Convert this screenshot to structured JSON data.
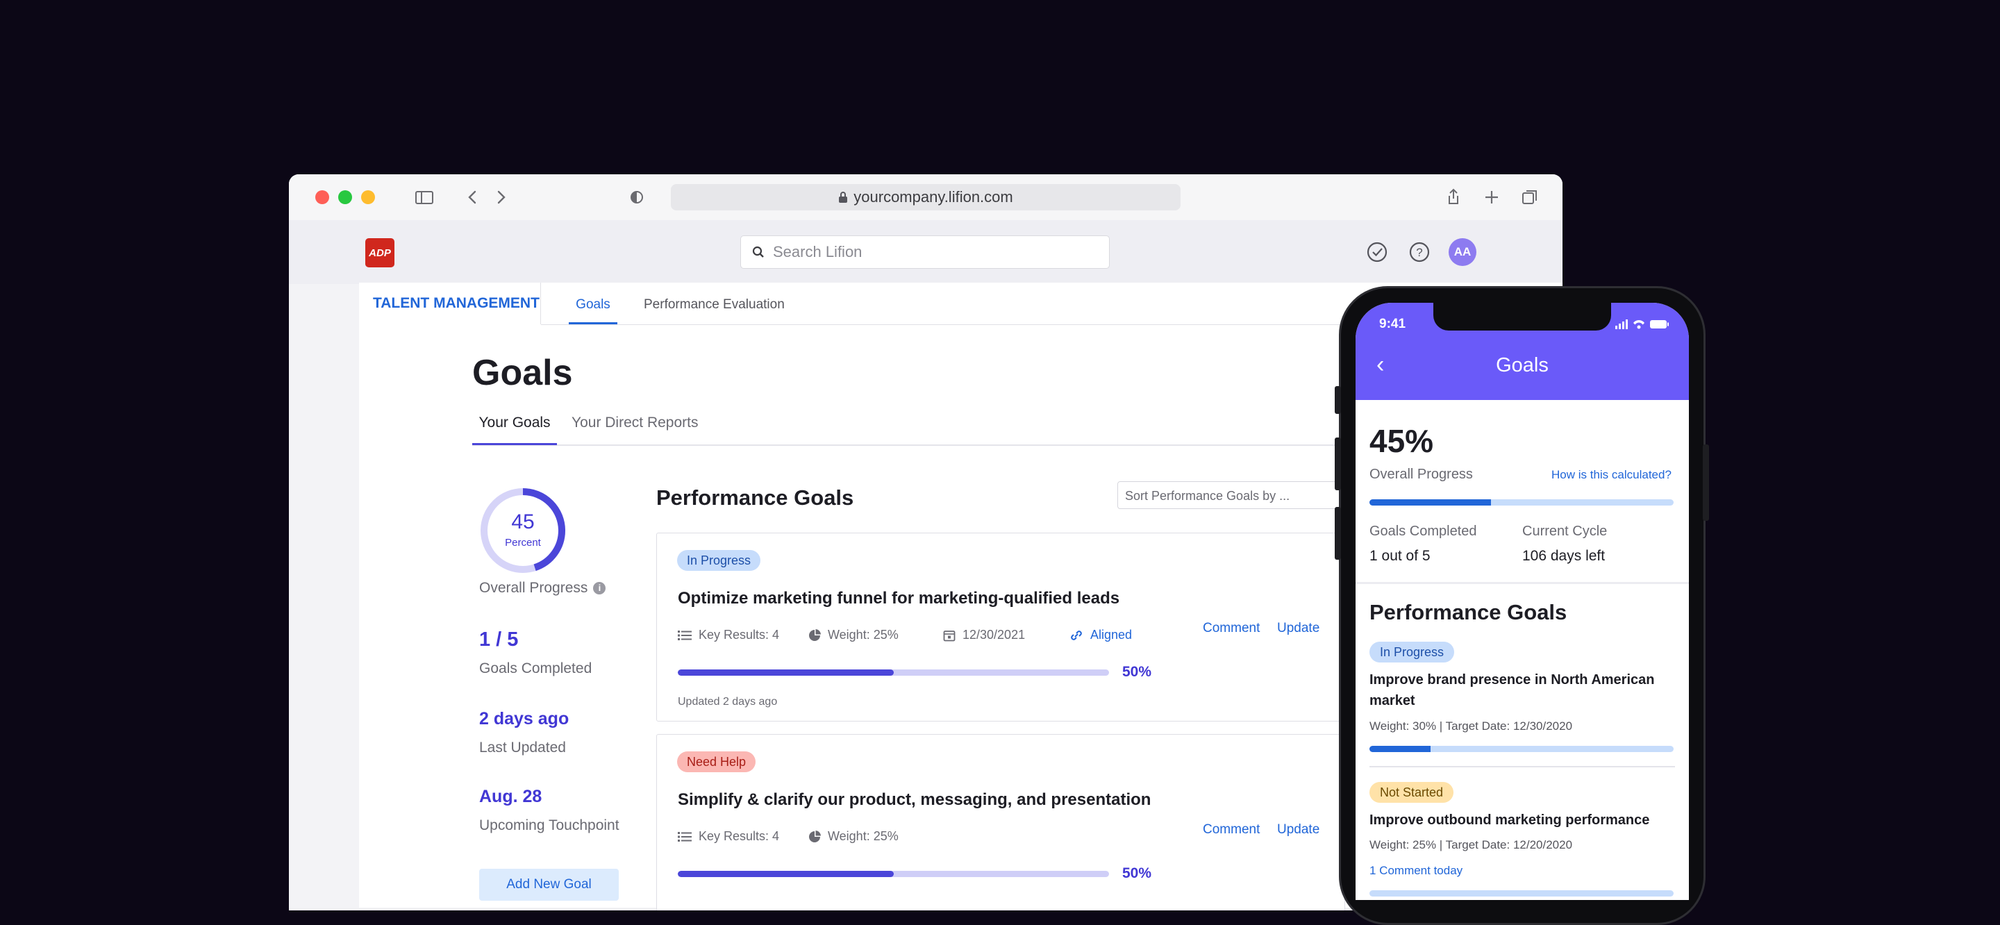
{
  "browser": {
    "url": "yourcompany.lifion.com",
    "colors": {
      "close": "#fe5f57",
      "minimize": "#28c840",
      "maximize": "#febc2e"
    }
  },
  "app": {
    "logo_text": "ADP",
    "search_placeholder": "Search Lifion",
    "avatar_initials": "AA",
    "module": "TALENT MANAGEMENT",
    "nav": [
      "Goals",
      "Performance Evaluation"
    ]
  },
  "page": {
    "title": "Goals",
    "tabs": [
      "Your Goals",
      "Your Direct Reports"
    ],
    "progress_ring": {
      "value": "45",
      "label": "Percent",
      "fraction": 0.45,
      "caption": "Overall Progress"
    },
    "stats": [
      {
        "value": "1 / 5",
        "label": "Goals Completed"
      },
      {
        "value": "2 days ago",
        "label": "Last Updated"
      },
      {
        "value": "Aug. 28",
        "label": "Upcoming Touchpoint"
      }
    ],
    "add_button": "Add New Goal",
    "perf_title": "Performance Goals",
    "sort_placeholder": "Sort Performance Goals by ...",
    "cards": [
      {
        "status": "In Progress",
        "title": "Optimize marketing funnel for marketing-qualified leads",
        "key_results": "Key Results: 4",
        "weight": "Weight: 25%",
        "date": "12/30/2021",
        "aligned": "Aligned",
        "comment": "Comment",
        "update": "Update",
        "progress": 0.5,
        "progress_label": "50%",
        "updated": "Updated 2 days ago"
      },
      {
        "status": "Need Help",
        "title": "Simplify & clarify our product, messaging, and presentation",
        "key_results": "Key Results: 4",
        "weight": "Weight: 25%",
        "comment": "Comment",
        "update": "Update",
        "progress": 0.5,
        "progress_label": "50%"
      }
    ]
  },
  "phone": {
    "time": "9:41",
    "title": "Goals",
    "overall_pct": "45%",
    "overall_label": "Overall Progress",
    "how_link": "How is this calculated?",
    "overall_progress": 0.4,
    "goals_completed_label": "Goals Completed",
    "goals_completed_value": "1 out of 5",
    "cycle_label": "Current Cycle",
    "cycle_value": "106 days left",
    "perf_title": "Performance Goals",
    "goals": [
      {
        "status": "In Progress",
        "title": "Improve brand presence in North American market",
        "meta": "Weight: 30%  |  Target Date: 12/30/2020",
        "progress": 0.2
      },
      {
        "status": "Not Started",
        "title": "Improve outbound marketing performance",
        "meta": "Weight: 25%  |  Target Date: 12/20/2020",
        "comment_link": "1 Comment today"
      }
    ]
  }
}
